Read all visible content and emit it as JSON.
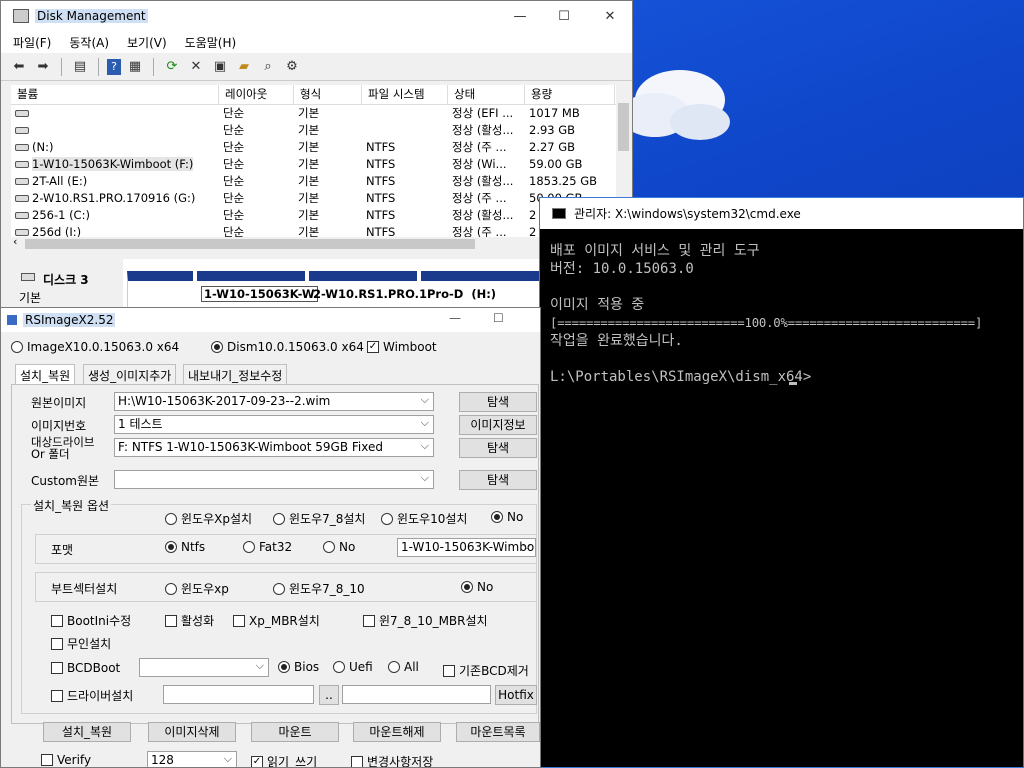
{
  "disk_mgmt": {
    "title": "Disk Management",
    "menu": [
      "파일(F)",
      "동작(A)",
      "보기(V)",
      "도움말(H)"
    ],
    "columns": [
      "볼륨",
      "레이아웃",
      "형식",
      "파일 시스템",
      "상태",
      "용량"
    ],
    "rows": [
      [
        "",
        "단순",
        "기본",
        "",
        "정상 (EFI ...",
        "1017 MB"
      ],
      [
        "",
        "단순",
        "기본",
        "",
        "정상 (활성...",
        "2.93 GB"
      ],
      [
        "(N:)",
        "단순",
        "기본",
        "NTFS",
        "정상 (주 ...",
        "2.27 GB"
      ],
      [
        "1-W10-15063K-Wimboot (F:)",
        "단순",
        "기본",
        "NTFS",
        "정상 (Wi...",
        "59.00 GB"
      ],
      [
        "2T-All (E:)",
        "단순",
        "기본",
        "NTFS",
        "정상 (활성...",
        "1853.25 GB"
      ],
      [
        "2-W10.RS1.PRO.170916 (G:)",
        "단순",
        "기본",
        "NTFS",
        "정상 (주 ...",
        "50.00 GB"
      ],
      [
        "256-1 (C:)",
        "단순",
        "기본",
        "NTFS",
        "정상 (활성...",
        "2"
      ],
      [
        "256d (I:)",
        "단순",
        "기본",
        "NTFS",
        "정상 (주 ...",
        "2"
      ]
    ],
    "disk_label": "디스크 3",
    "disk_type": "기본",
    "partitions": [
      "1-W10-15063K-W",
      "2-W10.RS1.PRO.1",
      "Pro-D  (H:)"
    ]
  },
  "cmd": {
    "title": "관리자: X:\\windows\\system32\\cmd.exe",
    "lines": [
      "배포 이미지 서비스 및 관리 도구",
      "버전: 10.0.15063.0",
      "",
      "이미지 적용 중",
      "[==========================100.0%==========================]",
      "작업을 완료했습니다.",
      "",
      "L:\\Portables\\RSImageX\\dism_x64>"
    ]
  },
  "rsimage": {
    "title": "RSImageX2.52",
    "mode_imagex": "ImageX10.0.15063.0 x64",
    "mode_dism": "Dism10.0.15063.0 x64",
    "wimboot": "Wimboot",
    "tabs": [
      "설치_복원",
      "생성_이미지추가",
      "내보내기_정보수정"
    ],
    "src_label": "원본이미지",
    "src_value": "H:\\W10-15063K-2017-09-23--2.wim",
    "imgno_label": "이미지번호",
    "imgno_value": "1  테스트",
    "target_label": "대상드라이브\nOr 폴더",
    "target_value": "F:  NTFS  1-W10-15063K-Wimboot      59GB  Fixed",
    "custom_label": "Custom원본",
    "custom_value": "",
    "btn_browse": "탐색",
    "btn_imginfo": "이미지정보",
    "options_title": "설치_복원 옵션",
    "os_options": [
      "윈도우Xp설치",
      "윈도우7_8설치",
      "윈도우10설치",
      "No"
    ],
    "format_label": "포맷",
    "format_options": [
      "Ntfs",
      "Fat32",
      "No"
    ],
    "format_select": "1-W10-15063K-Wimbo",
    "boot_label": "부트섹터설치",
    "boot_options": [
      "윈도우xp",
      "윈도우7_8_10",
      "No"
    ],
    "checks": [
      "BootIni수정",
      "활성화",
      "Xp_MBR설치",
      "윈7_8_10_MBR설치",
      "무인설치"
    ],
    "bcdboot": "BCDBoot",
    "bcd_options": [
      "Bios",
      "Uefi",
      "All"
    ],
    "bcd_remove": "기존BCD제거",
    "driver": "드라이버설치",
    "driver_btn": "..",
    "hotfix": "Hotfix",
    "actions": [
      "설치_복원",
      "이미지삭제",
      "마운트",
      "마운트해제",
      "마운트목록"
    ],
    "verify": "Verify",
    "size_value": "128",
    "readwrite": "읽기_쓰기",
    "save_changes": "변경사항저장"
  }
}
